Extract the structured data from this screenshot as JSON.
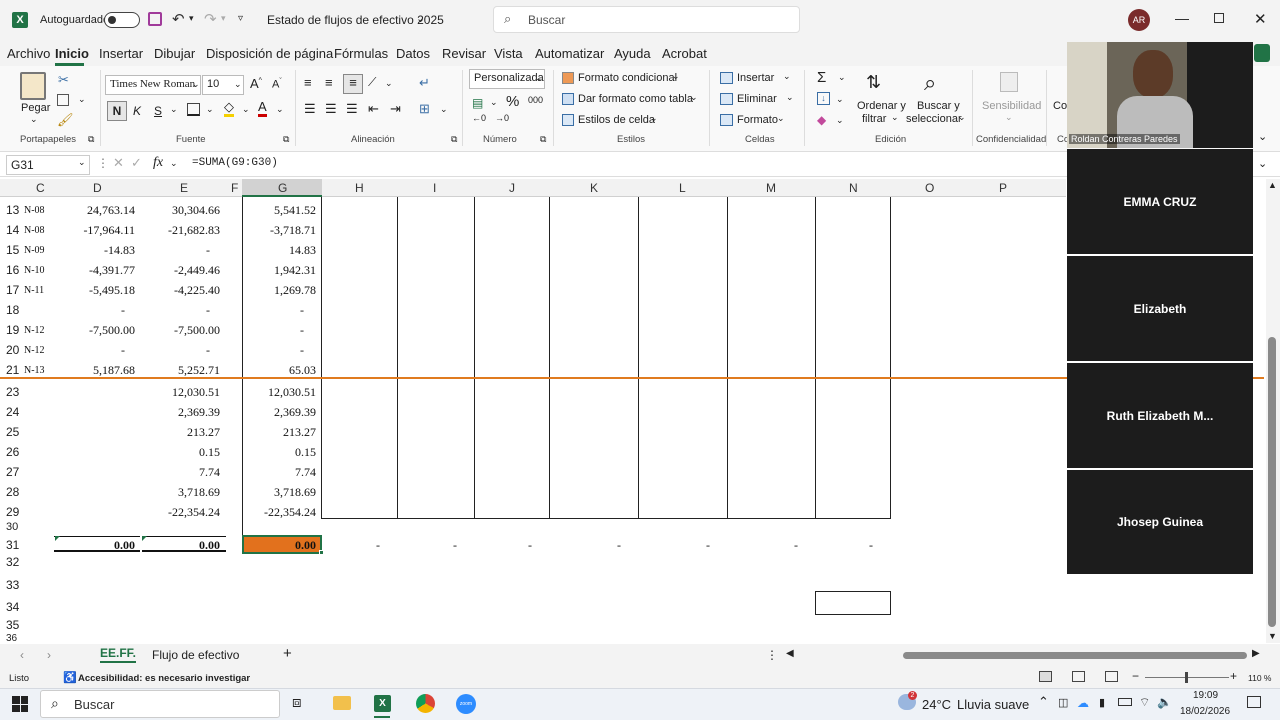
{
  "titlebar": {
    "autosave_label": "Autoguardado",
    "doc_title": "Estado de flujos de efectivo 2025",
    "search_placeholder": "Buscar",
    "avatar_initials": "AR"
  },
  "menu": [
    "Archivo",
    "Inicio",
    "Insertar",
    "Dibujar",
    "Disposición de página",
    "Fórmulas",
    "Datos",
    "Revisar",
    "Vista",
    "Automatizar",
    "Ayuda",
    "Acrobat"
  ],
  "ribbon": {
    "paste_label": "Pegar",
    "font_name": "Times New Roman",
    "font_size": "10",
    "bold": "N",
    "italic": "K",
    "underline": "S",
    "number_format": "Personalizada",
    "conditional_format": "Formato condicional",
    "format_as_table": "Dar formato como tabla",
    "cell_styles": "Estilos de celda",
    "insert": "Insertar",
    "delete": "Eliminar",
    "format": "Formato",
    "sort_filter_1": "Ordenar y",
    "sort_filter_2": "filtrar",
    "find_select_1": "Buscar y",
    "find_select_2": "seleccionar",
    "sensitivity": "Sensibilidad",
    "co_partial": "Co",
    "groups": {
      "clipboard": "Portapapeles",
      "font": "Fuente",
      "alignment": "Alineación",
      "number": "Número",
      "styles": "Estilos",
      "cells": "Celdas",
      "editing": "Edición",
      "confidentiality": "Confidencialidad",
      "co_group": "Co"
    }
  },
  "formula_bar": {
    "name_box": "G31",
    "fx": "fx",
    "formula": "=SUMA(G9:G30)"
  },
  "columns": [
    "C",
    "D",
    "E",
    "F",
    "G",
    "H",
    "I",
    "J",
    "K",
    "L",
    "M",
    "N",
    "O",
    "P"
  ],
  "rows": [
    {
      "n": "13",
      "c": "N-08",
      "d": "24,763.14",
      "e": "30,304.66",
      "g": "5,541.52"
    },
    {
      "n": "14",
      "c": "N-08",
      "d": "-17,964.11",
      "e": "-21,682.83",
      "g": "-3,718.71"
    },
    {
      "n": "15",
      "c": "N-09",
      "d": "-14.83",
      "e": "-",
      "g": "14.83"
    },
    {
      "n": "16",
      "c": "N-10",
      "d": "-4,391.77",
      "e": "-2,449.46",
      "g": "1,942.31"
    },
    {
      "n": "17",
      "c": "N-11",
      "d": "-5,495.18",
      "e": "-4,225.40",
      "g": "1,269.78"
    },
    {
      "n": "18",
      "c": "",
      "d": "-",
      "e": "-",
      "g": "-"
    },
    {
      "n": "19",
      "c": "N-12",
      "d": "-7,500.00",
      "e": "-7,500.00",
      "g": "-"
    },
    {
      "n": "20",
      "c": "N-12",
      "d": "-",
      "e": "-",
      "g": "-"
    },
    {
      "n": "21",
      "c": "N-13",
      "d": "5,187.68",
      "e": "5,252.71",
      "g": "65.03"
    },
    {
      "n": "23",
      "c": "",
      "d": "",
      "e": "12,030.51",
      "g": "12,030.51"
    },
    {
      "n": "24",
      "c": "",
      "d": "",
      "e": "2,369.39",
      "g": "2,369.39"
    },
    {
      "n": "25",
      "c": "",
      "d": "",
      "e": "213.27",
      "g": "213.27"
    },
    {
      "n": "26",
      "c": "",
      "d": "",
      "e": "0.15",
      "g": "0.15"
    },
    {
      "n": "27",
      "c": "",
      "d": "",
      "e": "7.74",
      "g": "7.74"
    },
    {
      "n": "28",
      "c": "",
      "d": "",
      "e": "3,718.69",
      "g": "3,718.69"
    },
    {
      "n": "29",
      "c": "",
      "d": "",
      "e": "-22,354.24",
      "g": "-22,354.24"
    },
    {
      "n": "30",
      "c": "",
      "d": "",
      "e": "",
      "g": ""
    },
    {
      "n": "31",
      "c": "",
      "d": "0.00",
      "e": "0.00",
      "g": "0.00"
    },
    {
      "n": "32",
      "c": "",
      "d": "",
      "e": "",
      "g": ""
    },
    {
      "n": "33",
      "c": "",
      "d": "",
      "e": "",
      "g": ""
    },
    {
      "n": "34",
      "c": "",
      "d": "",
      "e": "",
      "g": ""
    },
    {
      "n": "35",
      "c": "",
      "d": "",
      "e": "",
      "g": ""
    },
    {
      "n": "36",
      "c": "",
      "d": "",
      "e": "",
      "g": ""
    }
  ],
  "row31_dashes": "-",
  "tabs": {
    "active": "EE.FF.",
    "other": "Flujo de efectivo",
    "add": "+"
  },
  "status": {
    "ready": "Listo",
    "accessibility": "Accesibilidad: es necesario investigar",
    "zoom": "110 %"
  },
  "meeting": {
    "self_name": "Roldan Contreras Paredes",
    "participants": [
      "EMMA CRUZ",
      "Elizabeth",
      "Ruth Elizabeth M...",
      "Jhosep Guinea"
    ]
  },
  "taskbar": {
    "search": "Buscar",
    "weather_temp": "24°C",
    "weather_desc": "Lluvia suave",
    "time": "19:09",
    "date": "18/02/2026",
    "notif_count": "2"
  },
  "colors": {
    "excel_green": "#217346",
    "selected_fill": "#e2711d",
    "separator_orange": "#e07b1f"
  }
}
